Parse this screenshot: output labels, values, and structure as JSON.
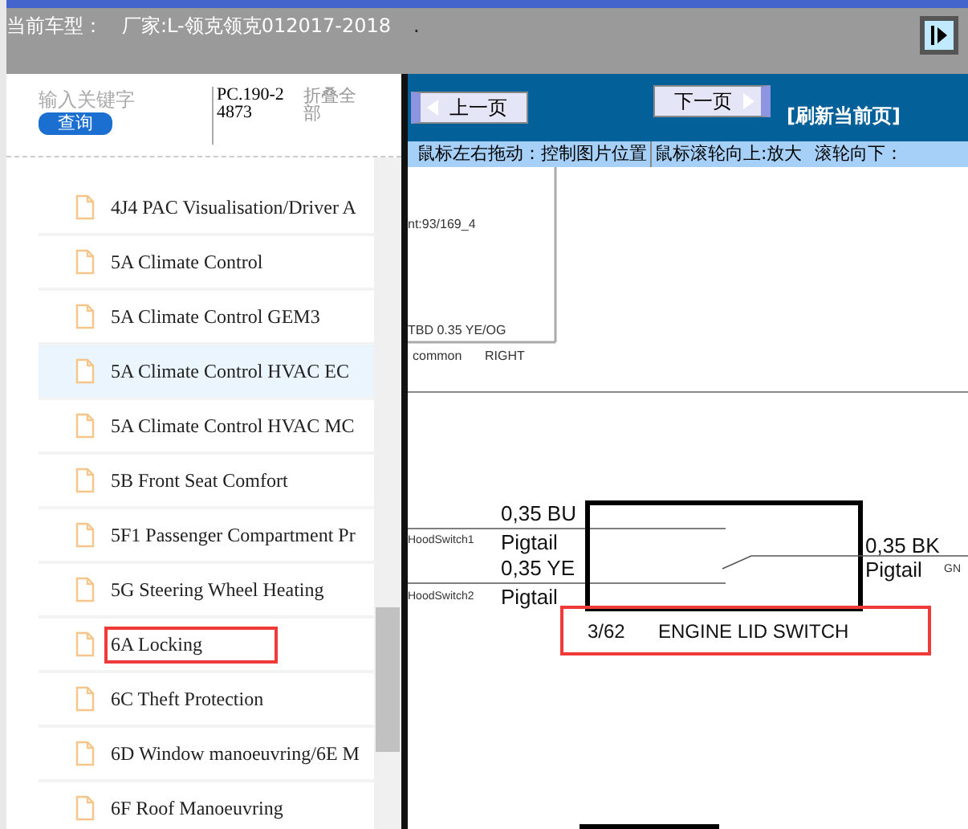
{
  "header": {
    "label": "当前车型：",
    "model": "厂家:L-领克领克012017-2018",
    "mark": "."
  },
  "search": {
    "placeholder": "输入关键字",
    "button": "查询",
    "code": "PC.190-24873",
    "collapse": "折叠全部"
  },
  "list": {
    "items": [
      {
        "label": "4J4 PAC Visualisation/Driver A",
        "selected": false,
        "annotated": false
      },
      {
        "label": "5A Climate Control",
        "selected": false,
        "annotated": false
      },
      {
        "label": "5A Climate Control GEM3",
        "selected": false,
        "annotated": false
      },
      {
        "label": "5A Climate Control HVAC EC",
        "selected": true,
        "annotated": false
      },
      {
        "label": "5A Climate Control HVAC MC",
        "selected": false,
        "annotated": false
      },
      {
        "label": "5B Front Seat Comfort",
        "selected": false,
        "annotated": false
      },
      {
        "label": "5F1 Passenger Compartment Pr",
        "selected": false,
        "annotated": false
      },
      {
        "label": "5G Steering Wheel Heating",
        "selected": false,
        "annotated": false
      },
      {
        "label": "6A Locking",
        "selected": false,
        "annotated": true
      },
      {
        "label": "6C Theft Protection",
        "selected": false,
        "annotated": false
      },
      {
        "label": "6D Window manoeuvring/6E M",
        "selected": false,
        "annotated": false
      },
      {
        "label": "6F Roof Manoeuvring",
        "selected": false,
        "annotated": false
      }
    ]
  },
  "toolbar": {
    "prev": "上一页",
    "next": "下一页",
    "refresh": "[刷新当前页]",
    "hints": [
      "鼠标左右拖动：控制图片位置",
      "鼠标滚轮向上:放大",
      "滚轮向下："
    ]
  },
  "diagram": {
    "upper_notes": [
      "nt:93/169_4",
      "TBD 0.35 YE/OG"
    ],
    "upper_footer": [
      "common",
      "RIGHT"
    ],
    "left_wires": [
      {
        "gauge": "0,35 BU",
        "type": "Pigtail",
        "pin": "HoodSwitch1"
      },
      {
        "gauge": "0,35 YE",
        "type": "Pigtail",
        "pin": "HoodSwitch2"
      }
    ],
    "right_wire": {
      "gauge": "0,35 BK",
      "type": "Pigtail",
      "pin": "GN"
    },
    "component": {
      "number": "3/62",
      "name": "ENGINE LID SWITCH",
      "annotated": true
    }
  }
}
